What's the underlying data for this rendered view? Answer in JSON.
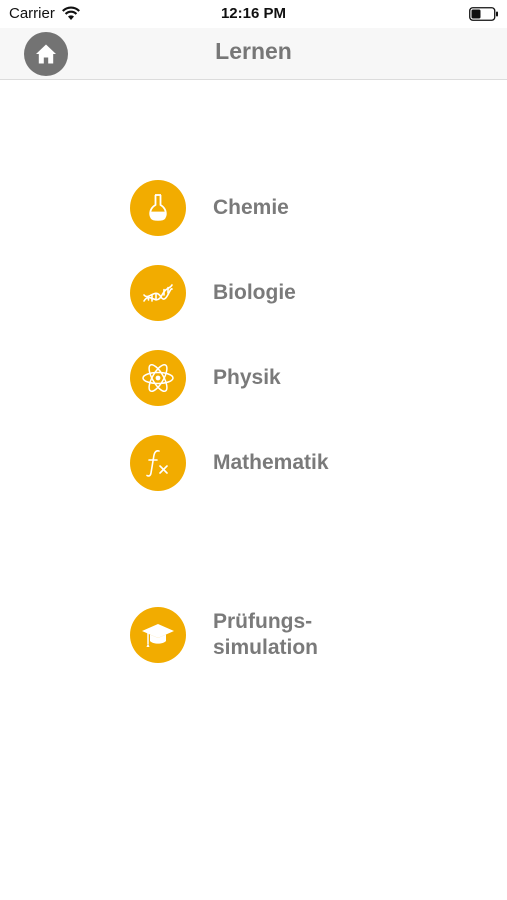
{
  "status": {
    "carrier": "Carrier",
    "time": "12:16 PM"
  },
  "nav": {
    "title": "Lernen",
    "home_icon": "home-icon"
  },
  "colors": {
    "accent": "#f2ac00",
    "nav_background": "#f7f7f7",
    "text": "#7a7a7a",
    "home_button": "#737373"
  },
  "menu": [
    {
      "label": "Chemie",
      "icon": "flask-icon"
    },
    {
      "label": "Biologie",
      "icon": "dna-icon"
    },
    {
      "label": "Physik",
      "icon": "atom-icon"
    },
    {
      "label": "Mathematik",
      "icon": "function-icon"
    }
  ],
  "exam": {
    "line1": "Prüfungs-",
    "line2": "simulation",
    "icon": "graduation-cap-icon"
  }
}
